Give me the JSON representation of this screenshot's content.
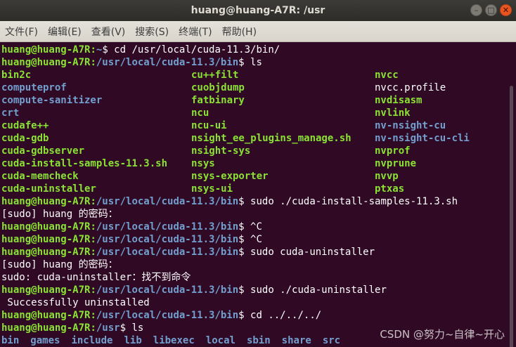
{
  "window": {
    "title": "huang@huang-A7R: /usr",
    "buttons": {
      "minimize": "–",
      "maximize": "□",
      "close": "✕"
    }
  },
  "menu": [
    "文件(F)",
    "编辑(E)",
    "查看(V)",
    "搜索(S)",
    "终端(T)",
    "帮助(H)"
  ],
  "terminal": {
    "user": "huang@huang-A7R",
    "lines": [
      {
        "kind": "prompt",
        "path": "~",
        "cmd": " cd /usr/local/cuda-11.3/bin/"
      },
      {
        "kind": "prompt",
        "path": "/usr/local/cuda-11.3/bin",
        "cmd": " ls"
      },
      {
        "kind": "cols",
        "cells": [
          [
            "bin2c",
            "exe"
          ],
          [
            "cu++filt",
            "exe"
          ],
          [
            "nvcc",
            "exe"
          ]
        ]
      },
      {
        "kind": "cols",
        "cells": [
          [
            "computeprof",
            "dir"
          ],
          [
            "cuobjdump",
            "exe"
          ],
          [
            "nvcc.profile",
            "plain"
          ]
        ]
      },
      {
        "kind": "cols",
        "cells": [
          [
            "compute-sanitizer",
            "dir"
          ],
          [
            "fatbinary",
            "exe"
          ],
          [
            "nvdisasm",
            "exe"
          ]
        ]
      },
      {
        "kind": "cols",
        "cells": [
          [
            "crt",
            "dir"
          ],
          [
            "ncu",
            "exe"
          ],
          [
            "nvlink",
            "exe"
          ]
        ]
      },
      {
        "kind": "cols",
        "cells": [
          [
            "cudafe++",
            "exe"
          ],
          [
            "ncu-ui",
            "exe"
          ],
          [
            "nv-nsight-cu",
            "dir"
          ]
        ]
      },
      {
        "kind": "cols",
        "cells": [
          [
            "cuda-gdb",
            "exe"
          ],
          [
            "nsight_ee_plugins_manage.sh",
            "exe"
          ],
          [
            "nv-nsight-cu-cli",
            "dir"
          ]
        ]
      },
      {
        "kind": "cols",
        "cells": [
          [
            "cuda-gdbserver",
            "exe"
          ],
          [
            "nsight-sys",
            "exe"
          ],
          [
            "nvprof",
            "exe"
          ]
        ]
      },
      {
        "kind": "cols",
        "cells": [
          [
            "cuda-install-samples-11.3.sh",
            "exe"
          ],
          [
            "nsys",
            "exe"
          ],
          [
            "nvprune",
            "exe"
          ]
        ]
      },
      {
        "kind": "cols",
        "cells": [
          [
            "cuda-memcheck",
            "exe"
          ],
          [
            "nsys-exporter",
            "exe"
          ],
          [
            "nvvp",
            "exe"
          ]
        ]
      },
      {
        "kind": "cols",
        "cells": [
          [
            "cuda-uninstaller",
            "exe"
          ],
          [
            "nsys-ui",
            "exe"
          ],
          [
            "ptxas",
            "exe"
          ]
        ]
      },
      {
        "kind": "prompt",
        "path": "/usr/local/cuda-11.3/bin",
        "cmd": " sudo ./cuda-install-samples-11.3.sh"
      },
      {
        "kind": "text",
        "text": "[sudo] huang 的密码："
      },
      {
        "kind": "prompt",
        "path": "/usr/local/cuda-11.3/bin",
        "cmd": " ^C"
      },
      {
        "kind": "prompt",
        "path": "/usr/local/cuda-11.3/bin",
        "cmd": " ^C"
      },
      {
        "kind": "prompt",
        "path": "/usr/local/cuda-11.3/bin",
        "cmd": " sudo cuda-uninstaller"
      },
      {
        "kind": "text",
        "text": "[sudo] huang 的密码："
      },
      {
        "kind": "text",
        "text": "sudo: cuda-uninstaller：找不到命令"
      },
      {
        "kind": "prompt",
        "path": "/usr/local/cuda-11.3/bin",
        "cmd": " sudo ./cuda-uninstaller"
      },
      {
        "kind": "text",
        "text": " Successfully uninstalled"
      },
      {
        "kind": "prompt",
        "path": "/usr/local/cuda-11.3/bin",
        "cmd": " cd ../../../"
      },
      {
        "kind": "prompt",
        "path": "/usr",
        "cmd": " ls"
      },
      {
        "kind": "lsdirs",
        "items": [
          "bin",
          "games",
          "include",
          "lib",
          "libexec",
          "local",
          "sbin",
          "share",
          "src"
        ]
      }
    ]
  },
  "watermark": "CSDN @努力~自律~开心",
  "colors": {
    "background": "#300a24",
    "prompt_user": "#8ae234",
    "prompt_path": "#729fcf"
  }
}
